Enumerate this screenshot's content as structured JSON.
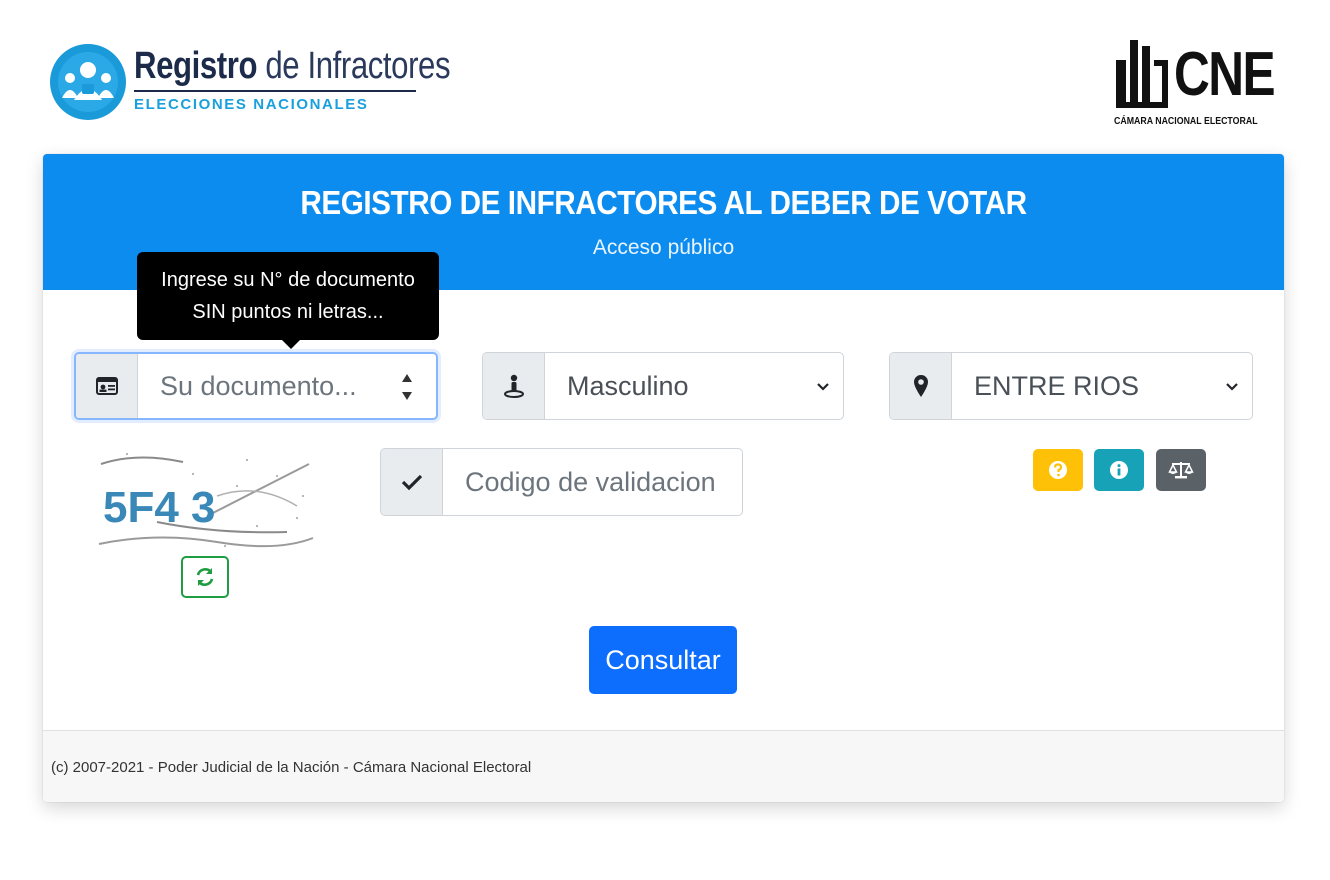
{
  "header": {
    "brand_title_bold": "Registro",
    "brand_title_light": " de Infractores",
    "brand_subtitle": "ELECCIONES NACIONALES",
    "cne_logo_text": "CNE",
    "cne_logo_subtitle": "CÁMARA NACIONAL ELECTORAL"
  },
  "card": {
    "title": "REGISTRO DE INFRACTORES AL DEBER DE VOTAR",
    "subtitle": "Acceso público"
  },
  "form": {
    "tooltip_line1": "Ingrese su N° de documento",
    "tooltip_line2": "SIN puntos ni letras...",
    "document": {
      "placeholder": "Su documento...",
      "value": ""
    },
    "gender": {
      "selected": "Masculino"
    },
    "province": {
      "selected": "ENTRE RIOS"
    },
    "validation": {
      "placeholder": "Codigo de validacion",
      "value": ""
    },
    "captcha_text": "5F4 3",
    "submit_label": "Consultar"
  },
  "icons": {
    "document": "id-card-icon",
    "gender": "person-icon",
    "province": "map-marker-icon",
    "validation": "check-icon",
    "refresh": "refresh-icon",
    "help": "question-icon",
    "info": "info-icon",
    "law": "balance-scale-icon"
  },
  "colors": {
    "header_blue": "#0d8cf0",
    "primary": "#0d6efd",
    "warning": "#ffc107",
    "info": "#17a2b8",
    "secondary": "#5a6268",
    "success": "#1f9d43"
  },
  "footer": {
    "text": "(c) 2007-2021 - Poder Judicial de la Nación - Cámara Nacional Electoral"
  }
}
